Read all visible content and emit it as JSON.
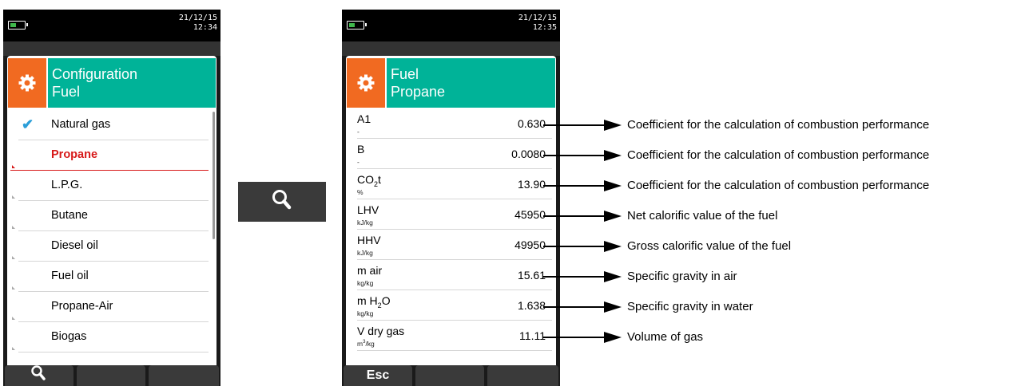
{
  "left_device": {
    "status": {
      "date": "21/12/15",
      "time": "12:34"
    },
    "header": {
      "line1": "Configuration",
      "line2": "Fuel",
      "icon": "gear-icon"
    },
    "items": [
      {
        "label": "Natural gas",
        "checked": true,
        "selected": false
      },
      {
        "label": "Propane",
        "checked": false,
        "selected": true
      },
      {
        "label": "L.P.G.",
        "checked": false,
        "selected": false
      },
      {
        "label": "Butane",
        "checked": false,
        "selected": false
      },
      {
        "label": "Diesel oil",
        "checked": false,
        "selected": false
      },
      {
        "label": "Fuel oil",
        "checked": false,
        "selected": false
      },
      {
        "label": "Propane-Air",
        "checked": false,
        "selected": false
      },
      {
        "label": "Biogas",
        "checked": false,
        "selected": false
      }
    ],
    "softkeys": [
      {
        "icon": "search-icon",
        "label": ""
      },
      {
        "label": ""
      },
      {
        "label": ""
      }
    ]
  },
  "middle_button": {
    "icon": "search-icon"
  },
  "right_device": {
    "status": {
      "date": "21/12/15",
      "time": "12:35"
    },
    "header": {
      "line1": "Fuel",
      "line2": "Propane",
      "icon": "gear-icon"
    },
    "params": [
      {
        "name": "A1",
        "unit": "-",
        "value": "0.630",
        "description": "Coefficient for the calculation of combustion performance"
      },
      {
        "name": "B",
        "unit": "-",
        "value": "0.0080",
        "description": "Coefficient for the calculation of combustion performance"
      },
      {
        "name_pre": "CO",
        "name_sub": "2",
        "name_post": "t",
        "unit": "%",
        "value": "13.90",
        "description": "Coefficient for the calculation of combustion performance"
      },
      {
        "name": "LHV",
        "unit": "kJ/kg",
        "value": "45950",
        "description": "Net calorific value of the fuel"
      },
      {
        "name": "HHV",
        "unit": "kJ/kg",
        "value": "49950",
        "description": "Gross calorific value of the fuel"
      },
      {
        "name": "m air",
        "unit": "kg/kg",
        "value": "15.61",
        "description": "Specific gravity in air"
      },
      {
        "name_pre": "m H",
        "name_sub": "2",
        "name_post": "O",
        "unit": "kg/kg",
        "value": "1.638",
        "description": "Specific gravity in water"
      },
      {
        "name": "V dry gas",
        "unit_pre": "m",
        "unit_sup": "3",
        "unit_post": "/kg",
        "value": "11.11",
        "description": "Volume of gas"
      }
    ],
    "softkeys": [
      {
        "label": "Esc"
      },
      {
        "label": ""
      },
      {
        "label": ""
      }
    ]
  },
  "colors": {
    "header_teal": "#00b398",
    "icon_orange": "#f16a21",
    "selected_red": "#d71a1a",
    "check_blue": "#2b9ed8",
    "battery_green": "#3fb84c"
  }
}
